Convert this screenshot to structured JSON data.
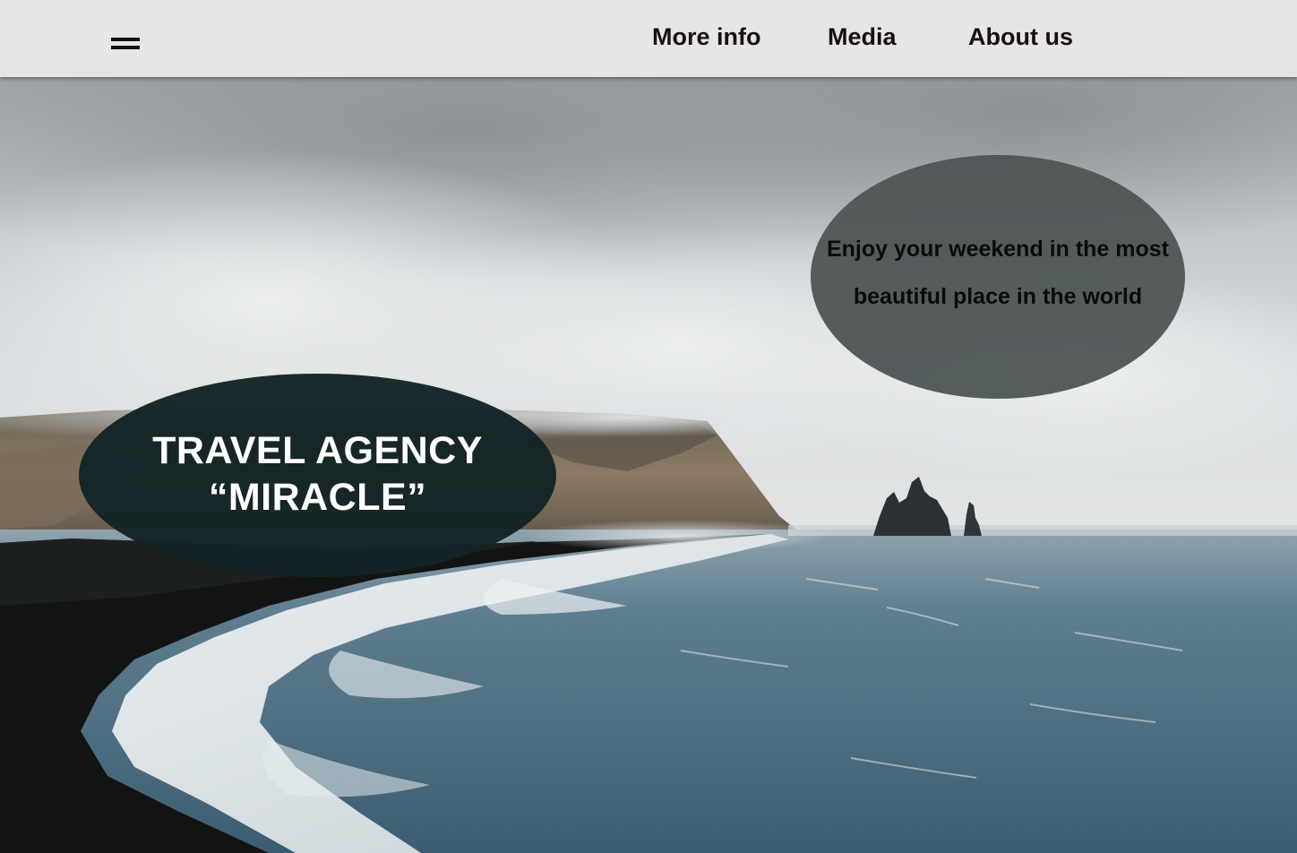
{
  "header": {
    "menu_icon": "hamburger-menu-icon",
    "nav": {
      "more_info": "More info",
      "media": "Media",
      "about_us": "About us"
    }
  },
  "hero": {
    "background": "coastal-seascape-with-cliffs-and-sea-stacks",
    "tagline": {
      "line1": "Enjoy your weekend in the most",
      "line2": "beautiful place in the world"
    },
    "title": {
      "line1": "TRAVEL AGENCY",
      "line2": "“MIRACLE”"
    }
  },
  "colors": {
    "header_bg": "#e6e6e6",
    "nav_text": "#1a1010",
    "tagline_oval": "#505656",
    "title_oval": "#142426",
    "title_text": "#ffffff"
  }
}
